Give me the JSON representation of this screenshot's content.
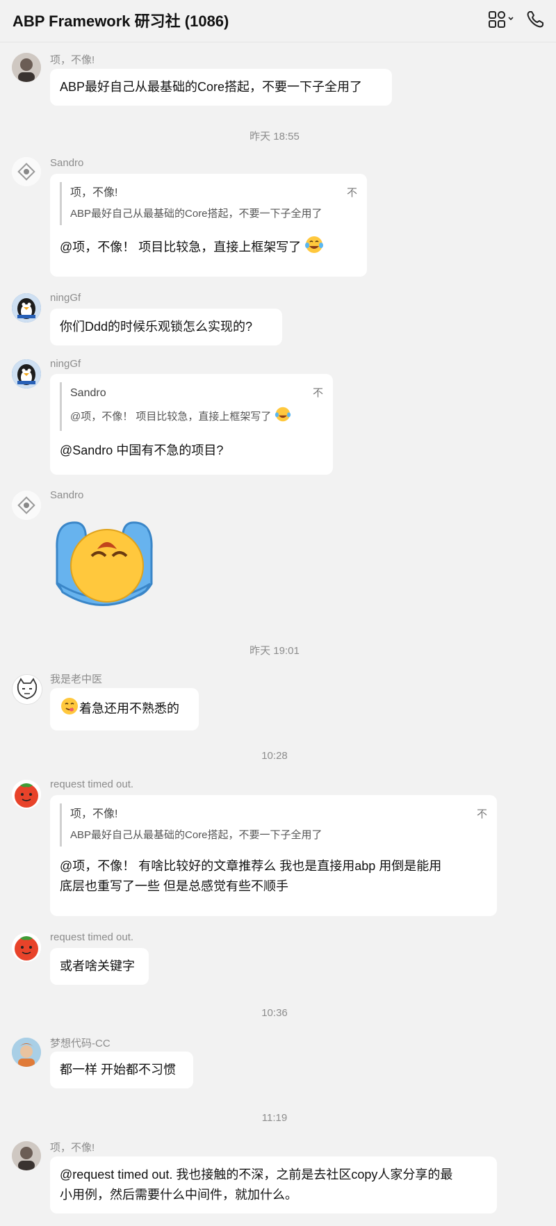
{
  "header": {
    "title": "ABP Framework 研习社 (1086)",
    "apps_icon": "apps-grid-icon",
    "call_icon": "phone-icon"
  },
  "messages": [
    {
      "sender": "项，不像!",
      "text": "ABP最好自己从最基础的Core搭起，不要一下子全用了"
    },
    {
      "sender": "Sandro",
      "quote_name": "项，不像!",
      "quote_text": "ABP最好自己从最基础的Core搭起，不要一下子全用了",
      "quote_pin": "不",
      "text": "@项，不像！ 项目比较急，直接上框架写了"
    },
    {
      "sender": "ningGf",
      "text": "你们Ddd的时候乐观锁怎么实现的?"
    },
    {
      "sender": "ningGf",
      "quote_name": "Sandro",
      "quote_text": "@项，不像！ 项目比较急，直接上框架写了",
      "quote_pin": "不",
      "text": "@Sandro 中国有不急的项目?"
    },
    {
      "sender": "Sandro",
      "sticker": "crying-laugh-sticker"
    },
    {
      "sender": "我是老中医",
      "text": "着急还用不熟悉的"
    },
    {
      "sender": "request timed out.",
      "quote_name": "项，不像!",
      "quote_text": "ABP最好自己从最基础的Core搭起，不要一下子全用了",
      "quote_pin": "不",
      "text_line1": "@项，不像！ 有啥比较好的文章推荐么 我也是直接用abp 用倒是能用",
      "text_line2": "底层也重写了一些 但是总感觉有些不顺手"
    },
    {
      "sender": "request timed out.",
      "text": "或者啥关键字"
    },
    {
      "sender": "梦想代码-CC",
      "text": "都一样 开始都不习惯"
    },
    {
      "sender": "项，不像!",
      "text_line1": "@request timed out. 我也接触的不深，之前是去社区copy人家分享的最",
      "text_line2": "小用例，然后需要什么中间件，就加什么。"
    }
  ],
  "timestamps": [
    "昨天 18:55",
    "昨天 19:01",
    "10:28",
    "10:36",
    "11:19"
  ],
  "colors": {
    "background": "#f2f2f2",
    "bubble": "#ffffff",
    "meta_text": "#8c8c8c"
  }
}
